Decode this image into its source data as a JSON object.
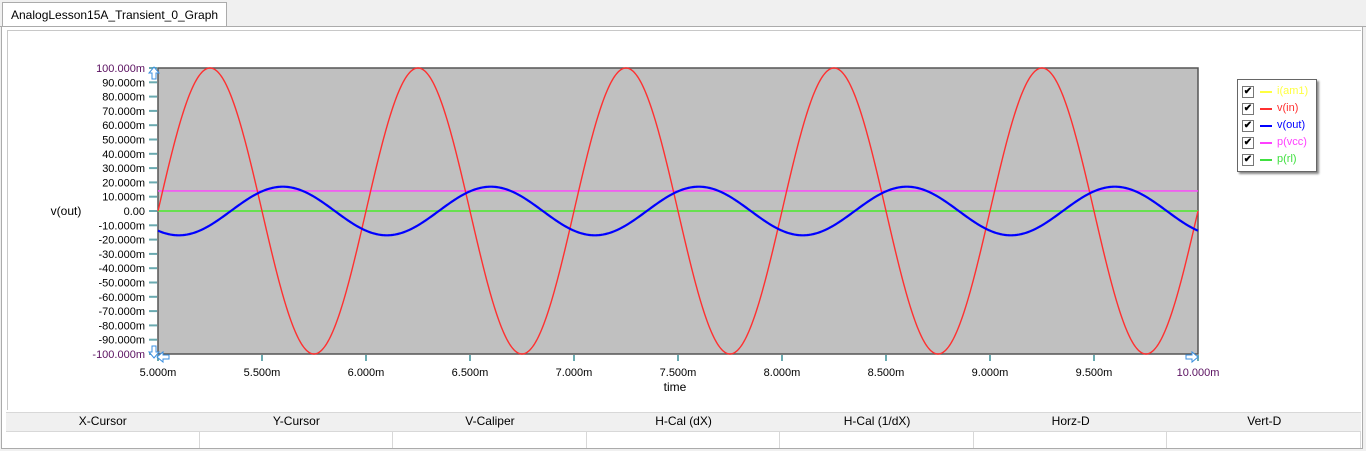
{
  "tab": {
    "title": "AnalogLesson15A_Transient_0_Graph"
  },
  "cursor_table": {
    "headers": [
      "X-Cursor",
      "Y-Cursor",
      "V-Caliper",
      "H-Cal (dX)",
      "H-Cal (1/dX)",
      "Horz-D",
      "Vert-D"
    ],
    "values": [
      "",
      "",
      "",
      "",
      "",
      "",
      ""
    ]
  },
  "chart_data": {
    "type": "line",
    "title": "",
    "xlabel": "time",
    "ylabel": "v(out)",
    "xlim": [
      5.0,
      10.0
    ],
    "ylim": [
      -100,
      100
    ],
    "x_units": "ms",
    "y_units": "mV",
    "x_ticks": [
      "5.000m",
      "5.500m",
      "6.000m",
      "6.500m",
      "7.000m",
      "7.500m",
      "8.000m",
      "8.500m",
      "9.000m",
      "9.500m",
      "10.000m"
    ],
    "y_ticks": [
      "100.000m",
      "90.000m",
      "80.000m",
      "70.000m",
      "60.000m",
      "50.000m",
      "40.000m",
      "30.000m",
      "20.000m",
      "10.000m",
      "0.00",
      "-10.000m",
      "-20.000m",
      "-30.000m",
      "-40.000m",
      "-50.000m",
      "-60.000m",
      "-70.000m",
      "-80.000m",
      "-90.000m",
      "-100.000m"
    ],
    "background": "#c0c0c0",
    "legend_position": "right",
    "series": [
      {
        "name": "i(am1)",
        "color": "#ffff40",
        "checked": true,
        "model": "sine",
        "amplitude": 0,
        "period": 1.0,
        "phase_zero": 5.0,
        "offset": 0
      },
      {
        "name": "v(in)",
        "color": "#ff3030",
        "checked": true,
        "model": "sine",
        "amplitude": 100,
        "period": 1.0,
        "phase_zero": 5.0,
        "offset": 0
      },
      {
        "name": "v(out)",
        "color": "#0000ff",
        "checked": true,
        "model": "sine",
        "amplitude": 17,
        "period": 1.0,
        "phase_zero": 5.35,
        "offset": 0
      },
      {
        "name": "p(vcc)",
        "color": "#ff40ff",
        "checked": true,
        "model": "sine",
        "amplitude": 0,
        "period": 1.0,
        "phase_zero": 5.0,
        "offset": 14
      },
      {
        "name": "p(rl)",
        "color": "#40e040",
        "checked": true,
        "model": "sine",
        "amplitude": 0,
        "period": 1.0,
        "phase_zero": 5.0,
        "offset": 0
      }
    ]
  }
}
